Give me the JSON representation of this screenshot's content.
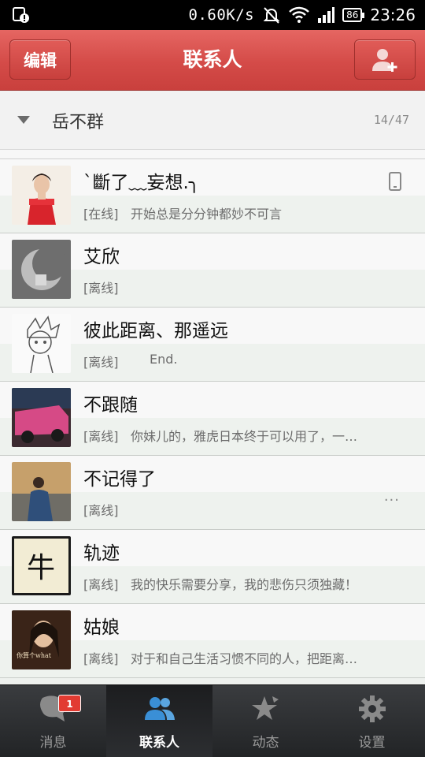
{
  "status_bar": {
    "net_speed": "0.60K/s",
    "battery": "86",
    "time": "23:26"
  },
  "header": {
    "edit_label": "编辑",
    "title": "联系人"
  },
  "group": {
    "name": "岳不群",
    "count": "14/47"
  },
  "contacts": [
    {
      "name": "ˋ斷了﹏妄想.╮",
      "status": "[在线]",
      "signature": "开始总是分分钟都妙不可言"
    },
    {
      "name": "艾欣",
      "status": "[离线]",
      "signature": ""
    },
    {
      "name": "彼此距离、那遥远",
      "status": "[离线]",
      "signature": "End."
    },
    {
      "name": "不跟随",
      "status": "[离线]",
      "signature": "你妹儿的，雅虎日本终于可以用了，一…"
    },
    {
      "name": "不记得了",
      "status": "[离线]",
      "signature": ""
    },
    {
      "name": "轨迹",
      "status": "[离线]",
      "signature": "我的快乐需要分享，我的悲伤只须独藏！"
    },
    {
      "name": "姑娘",
      "status": "[离线]",
      "signature": "对于和自己生活习惯不同的人，把距离…"
    }
  ],
  "avatar_texts": {
    "guiji": "牛",
    "guniang": "你算个what"
  },
  "more_indicator": "···",
  "tabs": [
    {
      "label": "消息",
      "badge": "1"
    },
    {
      "label": "联系人"
    },
    {
      "label": "动态"
    },
    {
      "label": "设置"
    }
  ],
  "colors": {
    "header_red": "#d44b48",
    "online_text": "#6c6c6c",
    "badge_red": "#e23b32",
    "active_tab_icon": "#3a8fd6"
  }
}
